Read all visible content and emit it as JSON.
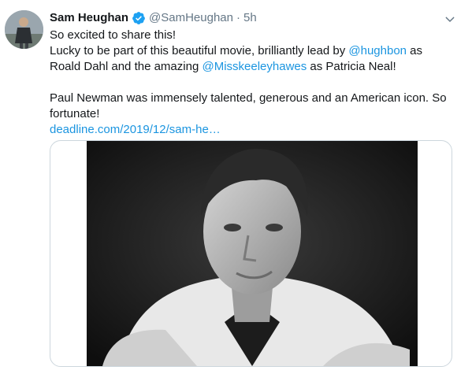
{
  "author": {
    "name": "Sam Heughan",
    "handle": "@SamHeughan",
    "separator": "·",
    "time": "5h"
  },
  "icons": {
    "verified": "verified-badge-icon",
    "menu": "chevron-down-icon"
  },
  "colors": {
    "link": "#1b95e0",
    "secondary_text": "#657786",
    "verified": "#1da1f2"
  },
  "tweet": {
    "line1": "So excited to share this!",
    "line2_a": "Lucky to be part of this beautiful movie, brilliantly lead by ",
    "mention1": "@hughbon",
    "line2_b": " as",
    "line3_a": "Roald Dahl and the amazing ",
    "mention2": "@Misskeeleyhawes",
    "line3_b": " as Patricia Neal!",
    "line4": "Paul Newman was immensely talented, generous and an American icon. So",
    "line5": "fortunate!",
    "link": "deadline.com/2019/12/sam-he…"
  }
}
